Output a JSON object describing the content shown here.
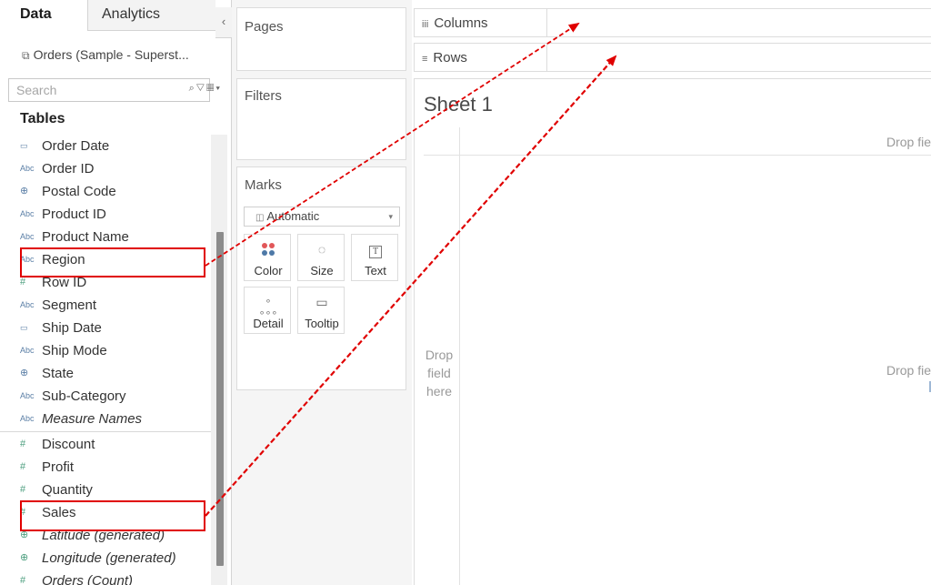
{
  "tabs": {
    "data": "Data",
    "analytics": "Analytics",
    "collapse": "‹"
  },
  "datasource": {
    "name": "Orders (Sample - Superst..."
  },
  "search": {
    "placeholder": "Search"
  },
  "tables_title": "Tables",
  "fields": [
    {
      "name": "Order Date",
      "icon": "calendar-icon",
      "glyph": "▭"
    },
    {
      "name": "Order ID",
      "icon": "abc-icon",
      "glyph": "Abc"
    },
    {
      "name": "Postal Code",
      "icon": "globe-icon",
      "glyph": "⊕"
    },
    {
      "name": "Product ID",
      "icon": "abc-icon",
      "glyph": "Abc"
    },
    {
      "name": "Product Name",
      "icon": "abc-icon",
      "glyph": "Abc"
    },
    {
      "name": "Region",
      "icon": "abc-icon",
      "glyph": "Abc"
    },
    {
      "name": "Row ID",
      "icon": "hash-icon",
      "glyph": "#"
    },
    {
      "name": "Segment",
      "icon": "abc-icon",
      "glyph": "Abc"
    },
    {
      "name": "Ship Date",
      "icon": "calendar-icon",
      "glyph": "▭"
    },
    {
      "name": "Ship Mode",
      "icon": "abc-icon",
      "glyph": "Abc"
    },
    {
      "name": "State",
      "icon": "globe-icon",
      "glyph": "⊕"
    },
    {
      "name": "Sub-Category",
      "icon": "abc-icon",
      "glyph": "Abc"
    },
    {
      "name": "Measure Names",
      "icon": "abc-icon",
      "glyph": "Abc"
    },
    {
      "name": "Discount",
      "icon": "hash-icon",
      "glyph": "#"
    },
    {
      "name": "Profit",
      "icon": "hash-icon",
      "glyph": "#"
    },
    {
      "name": "Quantity",
      "icon": "hash-icon",
      "glyph": "#"
    },
    {
      "name": "Sales",
      "icon": "hash-icon",
      "glyph": "#"
    },
    {
      "name": "Latitude (generated)",
      "icon": "globe-icon",
      "glyph": "⊕"
    },
    {
      "name": "Longitude (generated)",
      "icon": "globe-icon",
      "glyph": "⊕"
    },
    {
      "name": "Orders (Count)",
      "icon": "hash-icon",
      "glyph": "#"
    }
  ],
  "cards": {
    "pages": "Pages",
    "filters": "Filters",
    "marks": "Marks"
  },
  "marks": {
    "type": "Automatic",
    "color": "Color",
    "size": "Size",
    "text": "Text",
    "detail": "Detail",
    "tooltip": "Tooltip",
    "text_glyph": "T"
  },
  "shelves": {
    "columns": "Columns",
    "rows": "Rows"
  },
  "view": {
    "sheet_title": "Sheet 1",
    "drop_top": "Drop fie",
    "drop_mid": "Drop fie",
    "drop_left": "Drop field here"
  },
  "colors": {
    "annotation": "#e00000",
    "dimension": "#5b7fa6",
    "measure": "#4c9e7e"
  }
}
